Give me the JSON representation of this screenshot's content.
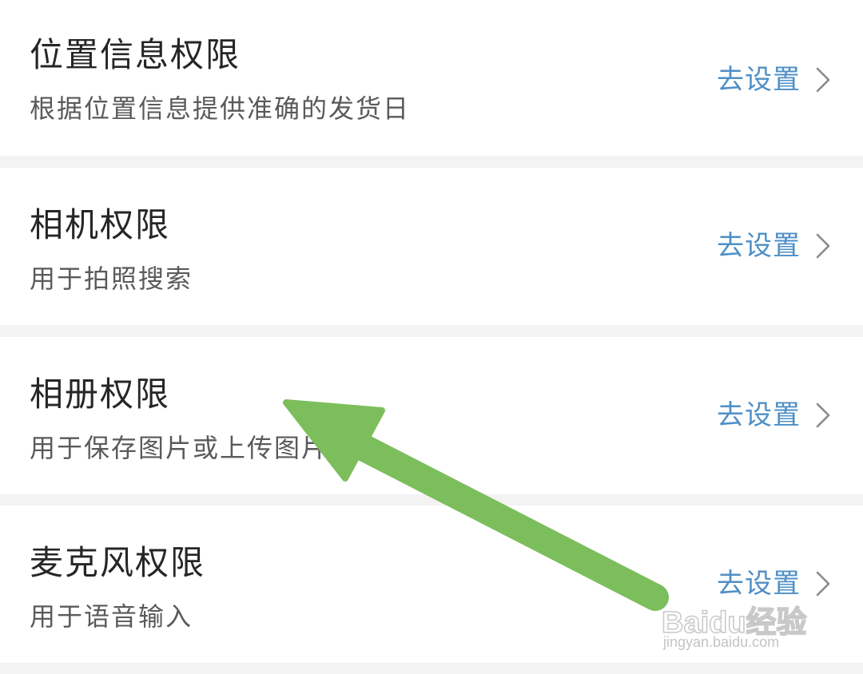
{
  "permissions": [
    {
      "title": "位置信息权限",
      "description": "根据位置信息提供准确的发货日",
      "action_label": "去设置"
    },
    {
      "title": "相机权限",
      "description": "用于拍照搜索",
      "action_label": "去设置"
    },
    {
      "title": "相册权限",
      "description": "用于保存图片或上传图片",
      "action_label": "去设置"
    },
    {
      "title": "麦克风权限",
      "description": "用于语音输入",
      "action_label": "去设置"
    }
  ],
  "colors": {
    "page_background": "#f3f3f3",
    "card_background": "#ffffff",
    "title_text": "#262626",
    "description_text": "#5a5a5a",
    "action_text": "#4e8fc7",
    "chevron": "#8a8a8a",
    "annotation_arrow": "#7cbe5c"
  },
  "icons": {
    "action_chevron": "chevron-right-icon"
  },
  "annotation": {
    "type": "arrow",
    "points_to": "相册权限"
  },
  "watermark": {
    "logo": "Baidu经验",
    "url": "jingyan.baidu.com"
  }
}
